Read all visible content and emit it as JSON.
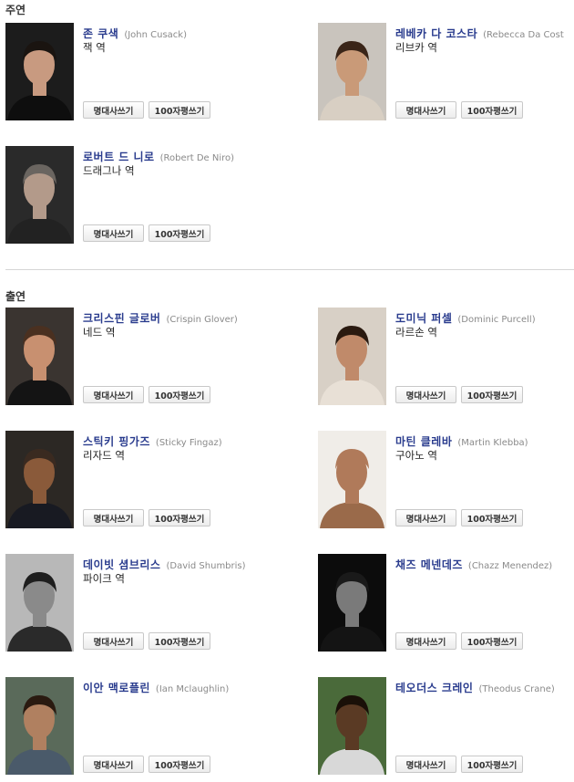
{
  "sections": [
    {
      "title": "주연"
    },
    {
      "title": "출연"
    }
  ],
  "buttons": {
    "quote": "명대사쓰기",
    "review": "100자평쓰기"
  },
  "cast": [
    {
      "name_ko": "존 쿠색",
      "name_en": "(John Cusack)",
      "role": "잭 역"
    },
    {
      "name_ko": "레베카 다 코스타",
      "name_en": "(Rebecca Da Cost",
      "role": "리브카 역"
    },
    {
      "name_ko": "로버트 드 니로",
      "name_en": "(Robert De Niro)",
      "role": "드래그나 역"
    },
    {
      "name_ko": "크리스핀 글로버",
      "name_en": "(Crispin Glover)",
      "role": "네드 역"
    },
    {
      "name_ko": "도미닉 퍼셀",
      "name_en": "(Dominic Purcell)",
      "role": "라르손 역"
    },
    {
      "name_ko": "스틱키 핑가즈",
      "name_en": "(Sticky Fingaz)",
      "role": "리자드 역"
    },
    {
      "name_ko": "마틴 클레바",
      "name_en": "(Martin Klebba)",
      "role": "구아노 역"
    },
    {
      "name_ko": "데이빗 셤브리스",
      "name_en": "(David Shumbris)",
      "role": "파이크 역"
    },
    {
      "name_ko": "채즈 메넨데즈",
      "name_en": "(Chazz Menendez)",
      "role": ""
    },
    {
      "name_ko": "이안 맥로플린",
      "name_en": "(Ian Mclaughlin)",
      "role": ""
    },
    {
      "name_ko": "테오더스 크레인",
      "name_en": "(Theodus Crane)",
      "role": ""
    }
  ],
  "photo_colors": [
    {
      "bg": "#1c1c1c",
      "skin": "#c89a80",
      "hair": "#1a1410",
      "shirt": "#0e0e0e"
    },
    {
      "bg": "#c9c4bd",
      "skin": "#c99a78",
      "hair": "#3a2518",
      "shirt": "#d8cfc3"
    },
    {
      "bg": "#2a2a2a",
      "skin": "#b39a8a",
      "hair": "#6a6560",
      "shirt": "#222222"
    },
    {
      "bg": "#3a3430",
      "skin": "#c89070",
      "hair": "#4a3020",
      "shirt": "#141414"
    },
    {
      "bg": "#d8d0c6",
      "skin": "#c08a6a",
      "hair": "#2a1a10",
      "shirt": "#e8e0d6"
    },
    {
      "bg": "#2c2824",
      "skin": "#8a5a3a",
      "hair": "#3a2a20",
      "shirt": "#181a22"
    },
    {
      "bg": "#f0ede8",
      "skin": "#b07a5a",
      "hair": "#b07a5a",
      "shirt": "#9a6a4a"
    },
    {
      "bg": "#b8b8b8",
      "skin": "#8a8a8a",
      "hair": "#1e1e1e",
      "shirt": "#2a2a2a"
    },
    {
      "bg": "#0c0c0c",
      "skin": "#7a7a7a",
      "hair": "#1a1a1a",
      "shirt": "#141414"
    },
    {
      "bg": "#5a6a5a",
      "skin": "#b08060",
      "hair": "#2a1a10",
      "shirt": "#4a5a6a"
    },
    {
      "bg": "#4a6a3a",
      "skin": "#5a3a24",
      "hair": "#1a1008",
      "shirt": "#d8d8d8"
    }
  ]
}
